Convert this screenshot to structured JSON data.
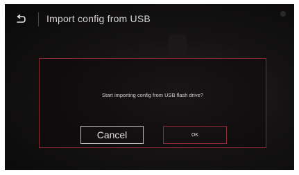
{
  "header": {
    "title": "Import config from USB",
    "back_icon": "back-arrow-icon"
  },
  "dialog": {
    "message": "Start importing config from USB flash drive?",
    "cancel_label": "Cancel",
    "ok_label": "OK"
  },
  "colors": {
    "accent": "#8c2a3a",
    "background": "#141213",
    "text": "#d8d6d6"
  }
}
